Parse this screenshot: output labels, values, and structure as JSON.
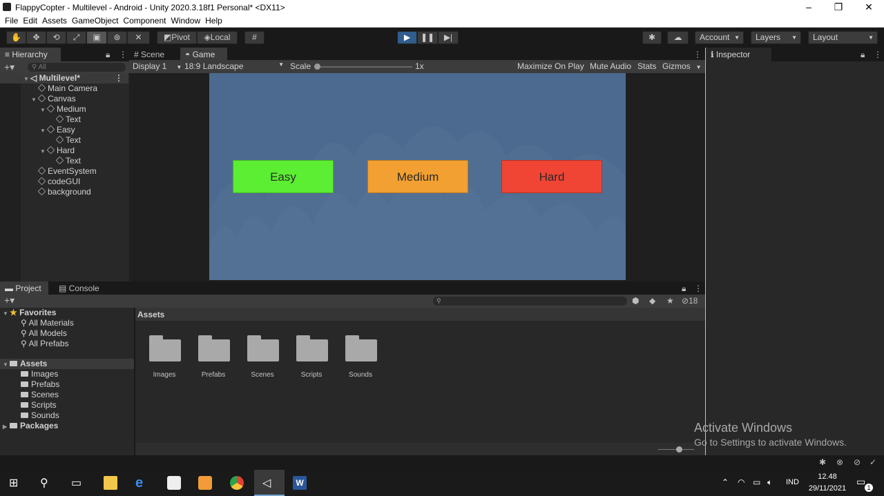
{
  "window": {
    "title": "FlappyCopter - Multilevel - Android - Unity 2020.3.18f1 Personal* <DX11>",
    "minimize": "–",
    "restore": "❐",
    "close": "✕"
  },
  "menu": [
    "File",
    "Edit",
    "Assets",
    "GameObject",
    "Component",
    "Window",
    "Help"
  ],
  "toolbar": {
    "pivot": "Pivot",
    "local": "Local",
    "account": "Account",
    "layers": "Layers",
    "layout": "Layout"
  },
  "hierarchy": {
    "tab": "Hierarchy",
    "search_placeholder": "All",
    "scene": "Multilevel*",
    "items": [
      {
        "label": "Main Camera",
        "depth": 1,
        "expand": false
      },
      {
        "label": "Canvas",
        "depth": 1,
        "expand": true
      },
      {
        "label": "Medium",
        "depth": 2,
        "expand": true
      },
      {
        "label": "Text",
        "depth": 3,
        "expand": false
      },
      {
        "label": "Easy",
        "depth": 2,
        "expand": true
      },
      {
        "label": "Text",
        "depth": 3,
        "expand": false
      },
      {
        "label": "Hard",
        "depth": 2,
        "expand": true
      },
      {
        "label": "Text",
        "depth": 3,
        "expand": false
      },
      {
        "label": "EventSystem",
        "depth": 1,
        "expand": false
      },
      {
        "label": "codeGUI",
        "depth": 1,
        "expand": false
      },
      {
        "label": "background",
        "depth": 1,
        "expand": false
      }
    ]
  },
  "scene_tabs": {
    "scene": "Scene",
    "game": "Game"
  },
  "game_toolbar": {
    "display": "Display 1",
    "aspect": "18:9 Landscape",
    "scale_label": "Scale",
    "scale_value": "1x",
    "maximize": "Maximize On Play",
    "mute": "Mute Audio",
    "stats": "Stats",
    "gizmos": "Gizmos"
  },
  "game_buttons": [
    {
      "label": "Easy",
      "color": "#5cee32"
    },
    {
      "label": "Medium",
      "color": "#f2a031"
    },
    {
      "label": "Hard",
      "color": "#f04434"
    }
  ],
  "inspector": {
    "tab": "Inspector"
  },
  "project": {
    "tab_project": "Project",
    "tab_console": "Console",
    "hidden_count": "18",
    "favorites": "Favorites",
    "favorites_items": [
      "All Materials",
      "All Models",
      "All Prefabs"
    ],
    "assets": "Assets",
    "assets_items": [
      "Images",
      "Prefabs",
      "Scenes",
      "Scripts",
      "Sounds"
    ],
    "packages": "Packages",
    "breadcrumb": "Assets",
    "folders": [
      "Images",
      "Prefabs",
      "Scenes",
      "Scripts",
      "Sounds"
    ]
  },
  "watermark": {
    "line1": "Activate Windows",
    "line2": "Go to Settings to activate Windows."
  },
  "taskbar": {
    "language": "IND",
    "time": "12.48",
    "date": "29/11/2021",
    "notification_count": "1"
  },
  "colors": {
    "game_background": "#4c6a8f",
    "play_active": "#2f5d8d"
  }
}
